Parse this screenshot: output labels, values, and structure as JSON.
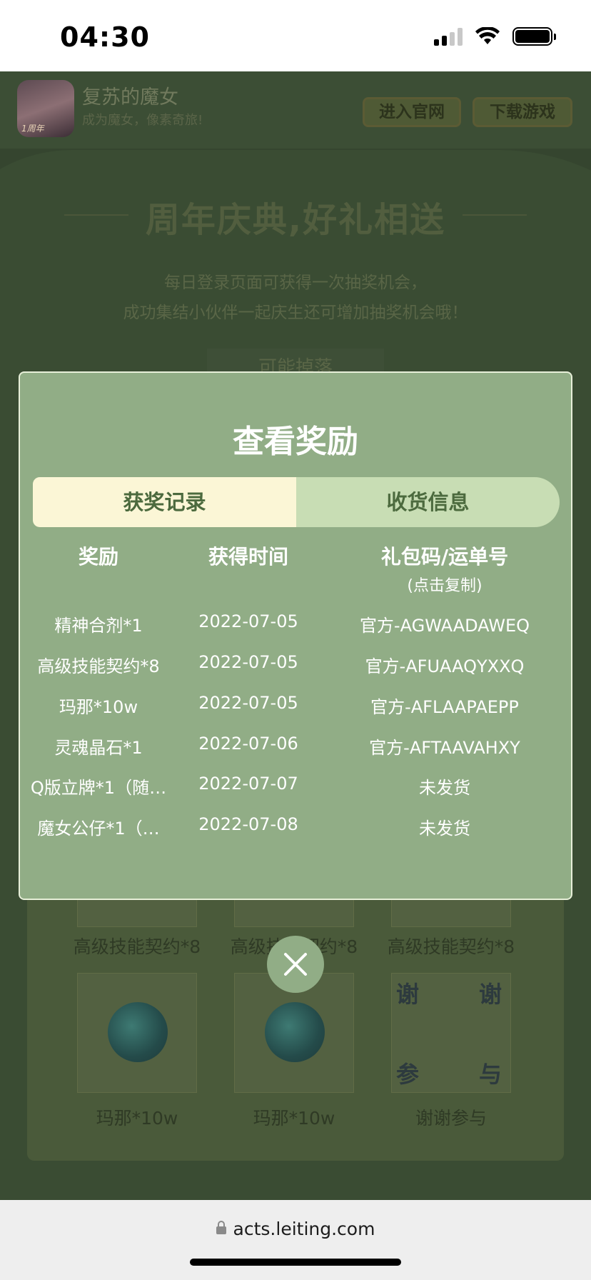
{
  "status_bar": {
    "time": "04:30"
  },
  "app_header": {
    "name": "复苏的魔女",
    "tagline": "成为魔女，像素奇旅!",
    "logo_text": "1周年",
    "official_site_button": "进入官网",
    "download_button": "下载游戏"
  },
  "promo": {
    "title": "周年庆典,好礼相送",
    "desc_line1": "每日登录页面可获得一次抽奖机会，",
    "desc_line2": "成功集结小伙伴一起庆生还可增加抽奖机会哦！",
    "drop_chip": "可能掉落"
  },
  "prize_grid": {
    "row1_labels": [
      "高级技能契约*8",
      "高级技能契约*8",
      "高级技能契约*8"
    ],
    "row2_labels": [
      "玛那*10w",
      "玛那*10w",
      "谢谢参与"
    ],
    "thanks_card_chars": [
      "谢",
      "谢",
      "参",
      "与"
    ]
  },
  "modal": {
    "title": "查看奖励",
    "tabs": [
      {
        "label": "获奖记录",
        "active": true
      },
      {
        "label": "收货信息",
        "active": false
      }
    ],
    "headers": {
      "reward": "奖励",
      "time": "获得时间",
      "code": "礼包码/运单号",
      "code_hint": "(点击复制)"
    },
    "rows": [
      {
        "reward": "精神合剂*1",
        "time": "2022-07-05",
        "code": "官方-AGWAADAWEQ"
      },
      {
        "reward": "高级技能契约*8",
        "time": "2022-07-05",
        "code": "官方-AFUAAQYXXQ"
      },
      {
        "reward": "玛那*10w",
        "time": "2022-07-05",
        "code": "官方-AFLAAPAEPP"
      },
      {
        "reward": "灵魂晶石*1",
        "time": "2022-07-06",
        "code": "官方-AFTAAVAHXY"
      },
      {
        "reward": "Q版立牌*1（随…",
        "time": "2022-07-07",
        "code": "未发货"
      },
      {
        "reward": "魔女公仔*1（…",
        "time": "2022-07-08",
        "code": "未发货"
      }
    ]
  },
  "browser": {
    "url": "acts.leiting.com"
  },
  "colors": {
    "modal_bg": "#91ad86",
    "tab_active": "#fbf6d6",
    "tab_inactive": "#c8ddb4"
  }
}
